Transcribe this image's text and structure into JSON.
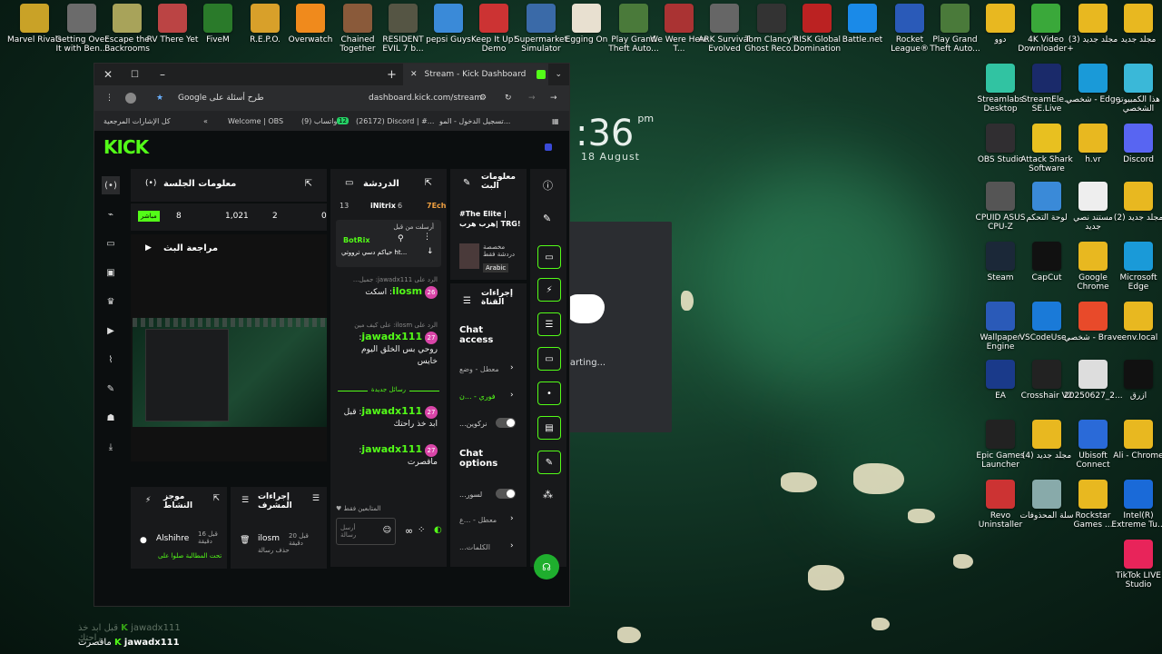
{
  "desktop": {
    "top_row": [
      {
        "label": "Marvel Rivals",
        "color": "#c9a227"
      },
      {
        "label": "Getting Over It with Ben...",
        "color": "#6b6b6b"
      },
      {
        "label": "Escape the Backrooms",
        "color": "#a8a35a"
      },
      {
        "label": "RV There Yet",
        "color": "#b44"
      },
      {
        "label": "FiveM",
        "color": "#2a7a2a"
      },
      {
        "label": "R.E.P.O.",
        "color": "#d8a02a"
      },
      {
        "label": "Overwatch",
        "color": "#f08a1c"
      },
      {
        "label": "Chained Together",
        "color": "#8a5a3a"
      },
      {
        "label": "RESIDENT EVIL 7 b...",
        "color": "#554"
      },
      {
        "label": "pepsi Guys",
        "color": "#3a8ad8"
      },
      {
        "label": "Keep It Up! Demo",
        "color": "#c33"
      },
      {
        "label": "Supermarket Simulator",
        "color": "#3a6aa8"
      },
      {
        "label": "Egging On",
        "color": "#e8e0d0"
      },
      {
        "label": "Play Grand Theft Auto...",
        "color": "#4a7a3a"
      },
      {
        "label": "We Were Here T...",
        "color": "#a33"
      },
      {
        "label": "ARK Survival Evolved",
        "color": "#666"
      },
      {
        "label": "Tom Clancy's Ghost Reco...",
        "color": "#333"
      },
      {
        "label": "RISK Global Domination",
        "color": "#b22"
      },
      {
        "label": "Battle.net",
        "color": "#1a8ae8"
      },
      {
        "label": "Rocket League®",
        "color": "#2a5ab8"
      },
      {
        "label": "Play Grand Theft Auto...",
        "color": "#4a7a3a"
      },
      {
        "label": "دوو",
        "color": "#e8b820"
      },
      {
        "label": "4K Video Downloader+",
        "color": "#3aa83a"
      },
      {
        "label": "مجلد جديد (3)",
        "color": "#e8b820"
      },
      {
        "label": "مجلد جديد",
        "color": "#e8b820"
      }
    ],
    "right_col1": [
      {
        "label": "Streamlabs Desktop",
        "color": "#31c3a2"
      },
      {
        "label": "OBS Studio",
        "color": "#302e31"
      },
      {
        "label": "CPUID ASUS CPU-Z",
        "color": "#555"
      },
      {
        "label": "Steam",
        "color": "#1b2838"
      },
      {
        "label": "Wallpaper Engine",
        "color": "#2a5ab8"
      },
      {
        "label": "EA",
        "color": "#1a3a8a"
      },
      {
        "label": "Epic Games Launcher",
        "color": "#222"
      },
      {
        "label": "Revo Uninstaller",
        "color": "#c33"
      }
    ],
    "right_col2": [
      {
        "label": "StreamEle... SE.Live",
        "color": "#1a2a6a"
      },
      {
        "label": "Attack Shark Software",
        "color": "#e8c020"
      },
      {
        "label": "لوحة التحكم",
        "color": "#3a8ad8"
      },
      {
        "label": "CapCut",
        "color": "#111"
      },
      {
        "label": "VSCodeUse...",
        "color": "#1a7ad8"
      },
      {
        "label": "Crosshair V2",
        "color": "#222"
      },
      {
        "label": "مجلد جديد (4)",
        "color": "#e8b820"
      },
      {
        "label": "سلة المحذوفات",
        "color": "#8aa"
      }
    ],
    "right_col3": [
      {
        "label": "شخصي - Edge",
        "color": "#1a9ad8"
      },
      {
        "label": "h.vr",
        "color": "#e8b820"
      },
      {
        "label": "مستند نصي جديد",
        "color": "#eee"
      },
      {
        "label": "Google Chrome",
        "color": "#e8b820"
      },
      {
        "label": "شخصي - Brave",
        "color": "#e84a2a"
      },
      {
        "label": "20250627_2...",
        "color": "#ddd"
      },
      {
        "label": "Ubisoft Connect",
        "color": "#2a6ad8"
      },
      {
        "label": "Rockstar Games ...",
        "color": "#e8b820"
      }
    ],
    "right_col4": [
      {
        "label": "هذا الكمبيوتر الشخصي",
        "color": "#3ab8d8"
      },
      {
        "label": "Discord",
        "color": "#5865f2"
      },
      {
        "label": "مجلد جديد (2)",
        "color": "#e8b820"
      },
      {
        "label": "Microsoft Edge",
        "color": "#1a9ad8"
      },
      {
        "label": ".env.local",
        "color": "#e8b820"
      },
      {
        "label": "ازرق",
        "color": "#111"
      },
      {
        "label": "Ali - Chrome",
        "color": "#e8b820"
      },
      {
        "label": "Intel(R) Extreme Tu...",
        "color": "#1a6ad8"
      },
      {
        "label": "TikTok LIVE Studio",
        "color": "#e8245a"
      }
    ],
    "clock_time": ":36",
    "clock_ampm": "pm",
    "clock_date": "18 August",
    "discord_status": "tarting...",
    "overlay_line1": "قبل ابد خذ راحتك",
    "overlay_user1": "jawadx111",
    "overlay_line2": "ماقصرت",
    "overlay_user2": "jawadx111"
  },
  "browser": {
    "tab_title": "Stream - Kick Dashboard",
    "url": "dashboard.kick.com/stream",
    "search_hint": "Google طرح أسئلة على",
    "bookmarks": [
      "Welcome | OBS",
      "واتساب (9)",
      "(26172) Discord | #...",
      "تسجيل الدخول - المو...",
      "كل الإشارات المرجعية"
    ],
    "bm_badge": "12"
  },
  "kick": {
    "logo": "KICK",
    "session": {
      "title": "معلومات الجلسة",
      "status": "مباشر",
      "stats": [
        "8",
        "1,021",
        "2",
        "0"
      ]
    },
    "preview_title": "مراجعة البث",
    "chat": {
      "title": "الدردشة",
      "top_users": [
        {
          "name": "iNitrix",
          "count": "6"
        },
        {
          "name": "7Ech",
          "count": ""
        }
      ],
      "top_count": "13",
      "pinned_by": "أرسلت من قبل",
      "pinned_user": "BotRix",
      "pinned_text": "حياكم دسي ترووتي ht...",
      "messages": [
        {
          "reply": "الرد على jawadx111: جميل...",
          "user": "ilosm",
          "badge": "26",
          "text": "اسكت"
        },
        {
          "reply": "الرد على ilosm: على كيف مين",
          "user": "jawadx111",
          "badge": "27",
          "text": "روحي بس الخلق اليوم خايس"
        },
        {
          "reply": "",
          "user": "jawadx111",
          "badge": "27",
          "text": "قبل ابد خذ راحتك"
        },
        {
          "reply": "",
          "user": "jawadx111",
          "badge": "27",
          "text": "ماقصرت"
        }
      ],
      "new_divider": "رسائل جديدة",
      "followers_only": "المتابعين فقط",
      "input_placeholder": "أرسل رسالة"
    },
    "stream_info": {
      "title": "معلومات البث",
      "stream_title": "#The Elite | هرب هرب| TRG!",
      "category": "مخصصة دردشة فقط",
      "language": "Arabic"
    },
    "channel_actions": {
      "title": "إجراءات القناة",
      "chat_access": "Chat access",
      "row1": "معطل - وضع",
      "row2": "فوري - ...ن",
      "row3": "...نركوين",
      "chat_options": "Chat options",
      "row4": "...لسور",
      "row5": "معطل - ...ع",
      "row6": "...الكلمات"
    },
    "activity": {
      "title": "موجز النشاط",
      "user": "Alshihre",
      "time": "قبل 16 دقيقة",
      "desc": "تحت المطالبة صلوا على"
    },
    "mod_actions": {
      "title": "إجراءات المشرف",
      "user": "ilosm",
      "time": "قبل 20 دقيقة",
      "desc": "حذف رسالة"
    }
  },
  "colors": {
    "kick_green": "#53fc18"
  }
}
